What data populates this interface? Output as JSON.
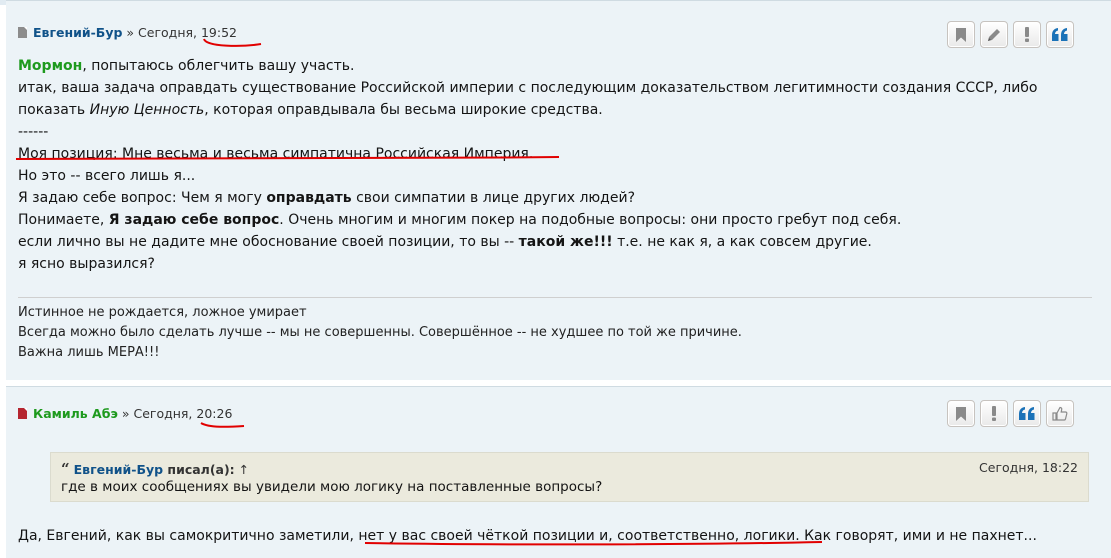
{
  "post1": {
    "author": "Евгений-Бур",
    "separator": " » ",
    "date_prefix": "Сегодня, ",
    "time": "19:52",
    "mention": "Мормон",
    "line1_rest": ", попытаюсь облегчить вашу участь.",
    "line2": "итак, ваша задача оправдать существование Российской империи с последующим доказательством легитимности создания СССР, либо",
    "line3_a": "показать ",
    "line3_em": "Иную Ценность",
    "line3_b": ", которая оправдывала бы весьма широкие средства.",
    "line4": "------",
    "line5": "Моя позиция: Мне весьма и весьма симпатична Российская Империя.",
    "line6": "Но это -- всего лишь я...",
    "line7_a": "Я задаю себе вопрос: Чем я могу ",
    "line7_b": "оправдать",
    "line7_c": " свои симпатии в лице других людей?",
    "line8_a": "Понимаете, ",
    "line8_b": "Я задаю себе вопрос",
    "line8_c": ". Очень многим и многим покер на подобные вопросы: они просто гребут под себя.",
    "line9_a": "если лично вы не дадите мне обоснование своей позиции, то вы -- ",
    "line9_b": "такой же!!!",
    "line9_c": " т.е. не как я, а как совсем другие.",
    "line10": "я ясно выразился?",
    "signature": [
      "Истинное не рождается, ложное умирает",
      "Всегда можно было сделать лучше -- мы не совершенны. Совершённое -- не худшее по той же причине.",
      "Важна лишь МЕРА!!!"
    ]
  },
  "post2": {
    "author": "Камиль Абэ",
    "separator": " » ",
    "date_prefix": "Сегодня, ",
    "time": "20:26",
    "quote": {
      "author": "Евгений-Бур",
      "wrote": " писал(а):",
      "arrow": "↑",
      "date": "Сегодня, 18:22",
      "text": "где в моих сообщениях вы увидели мою логику на поставленные вопросы?"
    },
    "reply_a": "Да, Евгений, как вы самокритично заметили, ",
    "reply_b": "нет у вас своей чёткой позиции и, соответственно, логики.",
    "reply_c": " Как говорят, ими и не пахнет..."
  },
  "icons": {
    "post1_buttons": [
      "bookmark-icon",
      "pencil-icon",
      "exclamation-icon",
      "quote-icon"
    ],
    "post2_buttons": [
      "bookmark-icon",
      "exclamation-icon",
      "quote-icon",
      "thumbs-up-icon"
    ]
  },
  "colors": {
    "post_bg": "#ecf3f7",
    "author_blue": "#105289",
    "author_green": "#1e9a1e",
    "annotation_red": "#e10000",
    "quote_bg": "#ebeadd",
    "quote_button_blue": "#1b72b8",
    "post_icon_grey": "#8c8c8c",
    "post_icon_red": "#b52530"
  }
}
